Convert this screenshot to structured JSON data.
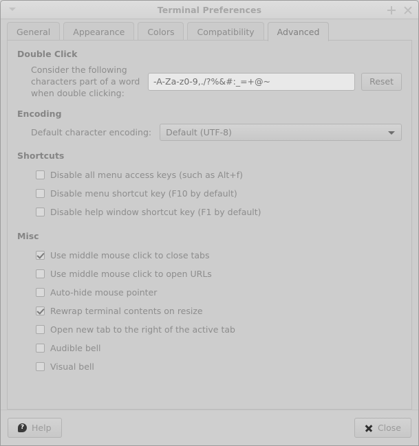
{
  "window": {
    "title": "Terminal Preferences",
    "menu_icon": "chevron-down-icon",
    "maximize_icon": "maximize-icon",
    "close_icon": "close-icon"
  },
  "tabs": [
    {
      "label": "General",
      "active": false
    },
    {
      "label": "Appearance",
      "active": false
    },
    {
      "label": "Colors",
      "active": false
    },
    {
      "label": "Compatibility",
      "active": false
    },
    {
      "label": "Advanced",
      "active": true
    }
  ],
  "groups": {
    "double_click": {
      "title": "Double Click",
      "label": "Consider the following characters part of a word when double clicking:",
      "value": "-A-Za-z0-9,./?%&#:_=+@~",
      "placeholder": "",
      "reset_label": "Reset"
    },
    "encoding": {
      "title": "Encoding",
      "label": "Default character encoding:",
      "selected": "Default (UTF-8)",
      "dropdown_icon": "chevron-down-icon"
    },
    "shortcuts": {
      "title": "Shortcuts",
      "items": [
        {
          "label": "Disable all menu access keys (such as Alt+f)",
          "checked": false
        },
        {
          "label": "Disable menu shortcut key (F10 by default)",
          "checked": false
        },
        {
          "label": "Disable help window shortcut key (F1 by default)",
          "checked": false
        }
      ]
    },
    "misc": {
      "title": "Misc",
      "items": [
        {
          "label": "Use middle mouse click to close tabs",
          "checked": true
        },
        {
          "label": "Use middle mouse click to open URLs",
          "checked": false
        },
        {
          "label": "Auto-hide mouse pointer",
          "checked": false
        },
        {
          "label": "Rewrap terminal contents on resize",
          "checked": true
        },
        {
          "label": "Open new tab to the right of the active tab",
          "checked": false
        },
        {
          "label": "Audible bell",
          "checked": false
        },
        {
          "label": "Visual bell",
          "checked": false
        }
      ]
    }
  },
  "actions": {
    "help_label": "Help",
    "help_icon": "help-question-icon",
    "help_glyph": "?",
    "close_label": "Close",
    "close_icon": "close-x-icon"
  },
  "colors": {
    "window_bg": "#cdcdcd",
    "titlebar_bg": "#d8d8d8",
    "text": "#8d8d8d",
    "heading": "#858585",
    "field_bg": "#e9e9e9",
    "border": "#b3b3b3"
  }
}
